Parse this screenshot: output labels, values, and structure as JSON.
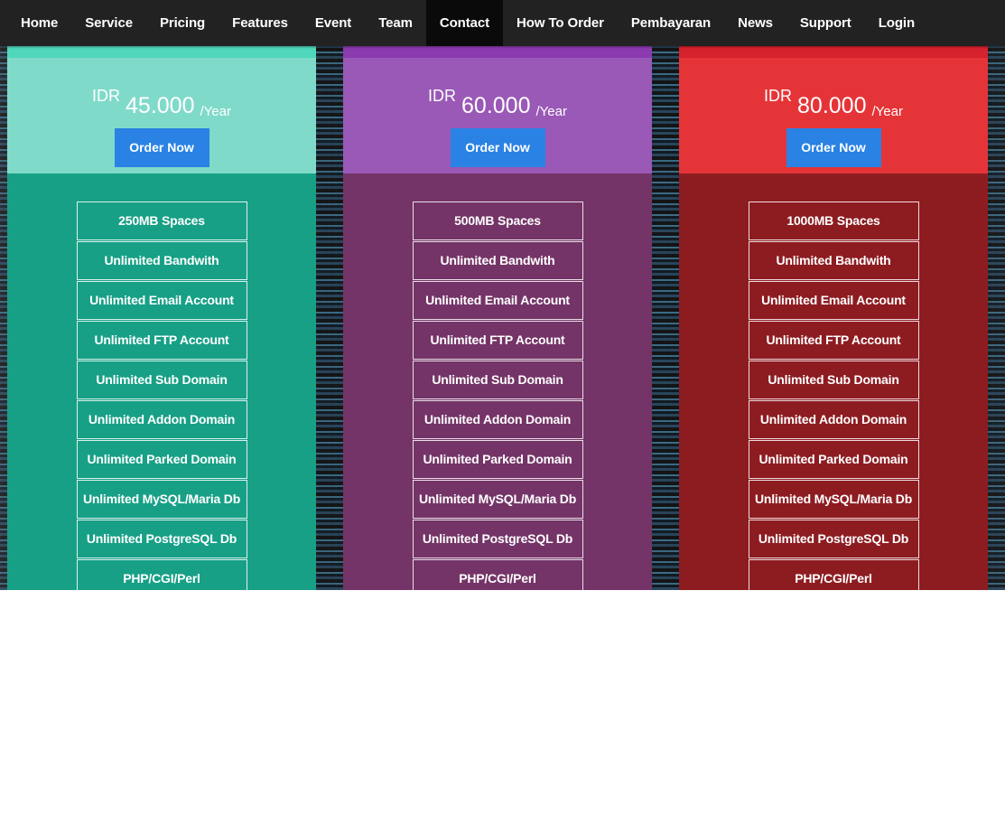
{
  "nav": {
    "items": [
      {
        "label": "Home"
      },
      {
        "label": "Service"
      },
      {
        "label": "Pricing"
      },
      {
        "label": "Features"
      },
      {
        "label": "Event"
      },
      {
        "label": "Team"
      },
      {
        "label": "Contact"
      },
      {
        "label": "How To Order"
      },
      {
        "label": "Pembayaran"
      },
      {
        "label": "News"
      },
      {
        "label": "Support"
      },
      {
        "label": "Login"
      }
    ],
    "active": "Contact"
  },
  "plans": [
    {
      "currency": "IDR",
      "amount": "45.000",
      "period": "/Year",
      "order_label": "Order Now",
      "features": [
        "250MB Spaces",
        "Unlimited Bandwith",
        "Unlimited Email Account",
        "Unlimited FTP Account",
        "Unlimited Sub Domain",
        "Unlimited Addon Domain",
        "Unlimited Parked Domain",
        "Unlimited MySQL/Maria Db",
        "Unlimited PostgreSQL Db",
        "PHP/CGI/Perl"
      ]
    },
    {
      "currency": "IDR",
      "amount": "60.000",
      "period": "/Year",
      "order_label": "Order Now",
      "features": [
        "500MB Spaces",
        "Unlimited Bandwith",
        "Unlimited Email Account",
        "Unlimited FTP Account",
        "Unlimited Sub Domain",
        "Unlimited Addon Domain",
        "Unlimited Parked Domain",
        "Unlimited MySQL/Maria Db",
        "Unlimited PostgreSQL Db",
        "PHP/CGI/Perl"
      ]
    },
    {
      "currency": "IDR",
      "amount": "80.000",
      "period": "/Year",
      "order_label": "Order Now",
      "features": [
        "1000MB Spaces",
        "Unlimited Bandwith",
        "Unlimited Email Account",
        "Unlimited FTP Account",
        "Unlimited Sub Domain",
        "Unlimited Addon Domain",
        "Unlimited Parked Domain",
        "Unlimited MySQL/Maria Db",
        "Unlimited PostgreSQL Db",
        "PHP/CGI/Perl"
      ]
    }
  ],
  "colors": {
    "nav_bg": "#222222",
    "button": "#2a82e4",
    "plan1": "#17a086",
    "plan2": "#743467",
    "plan3": "#8d1c21"
  }
}
